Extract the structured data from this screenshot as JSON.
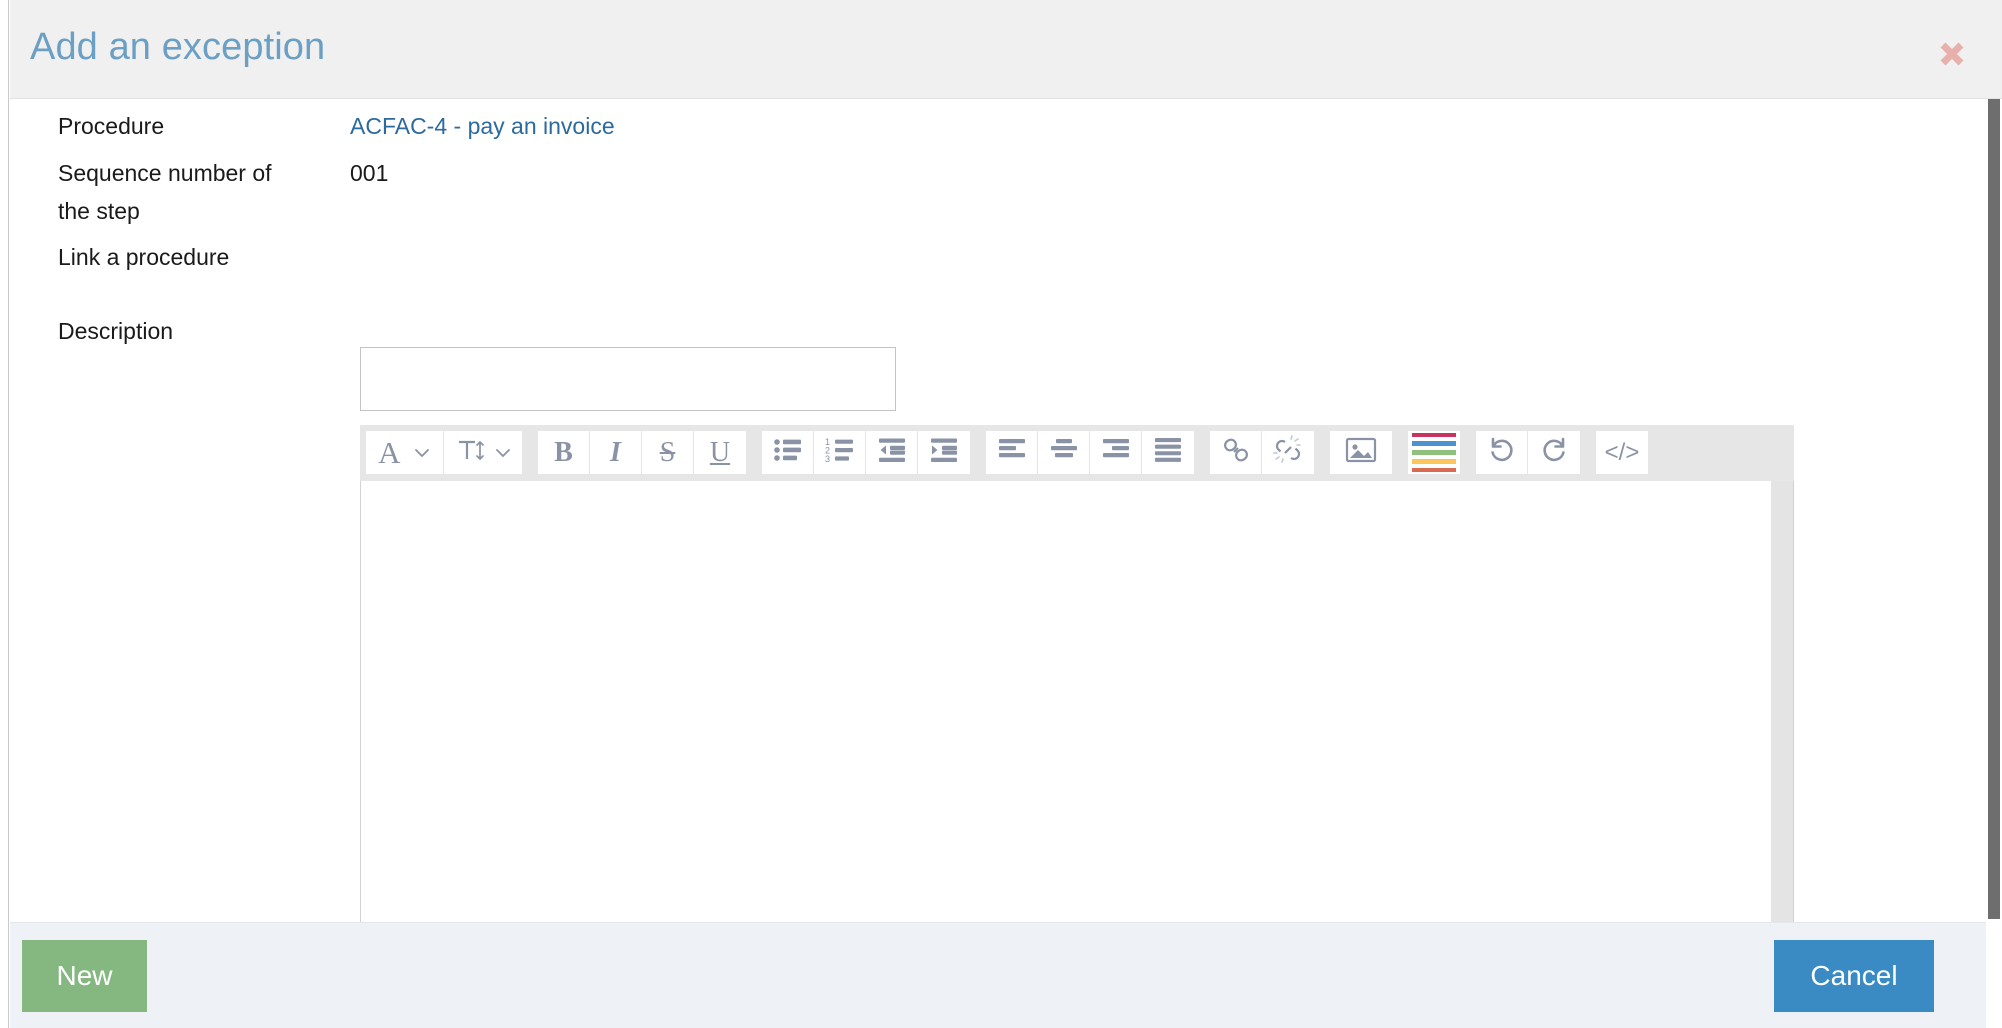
{
  "dialog": {
    "title": "Add an exception",
    "close_icon": "close-x-icon"
  },
  "form": {
    "fields": [
      {
        "label": "Procedure",
        "value": "ACFAC-4 - pay an invoice",
        "type": "link"
      },
      {
        "label": "Sequence number of the step",
        "value": "001",
        "type": "text"
      },
      {
        "label": "Link a procedure",
        "value": "",
        "type": "input"
      },
      {
        "label": "Description",
        "value": "",
        "type": "richtext"
      }
    ],
    "link_procedure_input": {
      "value": "",
      "placeholder": ""
    },
    "description_editor": {
      "content": "",
      "placeholder": ""
    }
  },
  "editor_toolbar": {
    "groups": [
      {
        "name": "font-group",
        "buttons": [
          {
            "name": "font-family-button",
            "glyph": "A",
            "icon": "font-family-icon",
            "has_chevron": true
          },
          {
            "name": "font-size-button",
            "glyph": "T",
            "icon": "font-size-icon",
            "has_chevron": true
          }
        ]
      },
      {
        "name": "style-group",
        "buttons": [
          {
            "name": "bold-button",
            "glyph": "B",
            "icon": "bold-icon"
          },
          {
            "name": "italic-button",
            "glyph": "I",
            "icon": "italic-icon"
          },
          {
            "name": "strikethrough-button",
            "glyph": "S",
            "icon": "strikethrough-icon"
          },
          {
            "name": "underline-button",
            "glyph": "U",
            "icon": "underline-icon"
          }
        ]
      },
      {
        "name": "list-group",
        "buttons": [
          {
            "name": "bullet-list-button",
            "icon": "bullet-list-icon"
          },
          {
            "name": "numbered-list-button",
            "icon": "numbered-list-icon"
          },
          {
            "name": "outdent-button",
            "icon": "outdent-icon"
          },
          {
            "name": "indent-button",
            "icon": "indent-icon"
          }
        ]
      },
      {
        "name": "align-group",
        "buttons": [
          {
            "name": "align-left-button",
            "icon": "align-left-icon"
          },
          {
            "name": "align-center-button",
            "icon": "align-center-icon"
          },
          {
            "name": "align-right-button",
            "icon": "align-right-icon"
          },
          {
            "name": "align-justify-button",
            "icon": "align-justify-icon"
          }
        ]
      },
      {
        "name": "link-group",
        "buttons": [
          {
            "name": "insert-link-button",
            "icon": "link-icon"
          },
          {
            "name": "remove-link-button",
            "icon": "unlink-icon"
          }
        ]
      },
      {
        "name": "insert-group",
        "buttons": [
          {
            "name": "insert-image-button",
            "icon": "image-icon"
          }
        ]
      },
      {
        "name": "color-group",
        "buttons": [
          {
            "name": "text-color-button",
            "icon": "color-palette-icon"
          }
        ]
      },
      {
        "name": "history-group",
        "buttons": [
          {
            "name": "undo-button",
            "icon": "undo-icon"
          },
          {
            "name": "redo-button",
            "icon": "redo-icon"
          }
        ]
      },
      {
        "name": "source-group",
        "buttons": [
          {
            "name": "code-view-button",
            "glyph": "</>",
            "icon": "code-view-icon"
          }
        ]
      }
    ],
    "color_palette": [
      "#c9335f",
      "#4b92cf",
      "#8fc07c",
      "#fbc55a",
      "#d96a52"
    ]
  },
  "footer": {
    "new_label": "New",
    "cancel_label": "Cancel"
  },
  "colors": {
    "title": "#6b9fc4",
    "link": "#2c6a9e",
    "header_bg": "#f0f0f0",
    "footer_bg": "#eef1f5",
    "new_button": "#85b881",
    "cancel_button": "#3a8ac4",
    "close_icon": "#e8b0ac",
    "toolbar_bg": "#e6e6e6",
    "toolbar_icon": "#8a93a5"
  }
}
